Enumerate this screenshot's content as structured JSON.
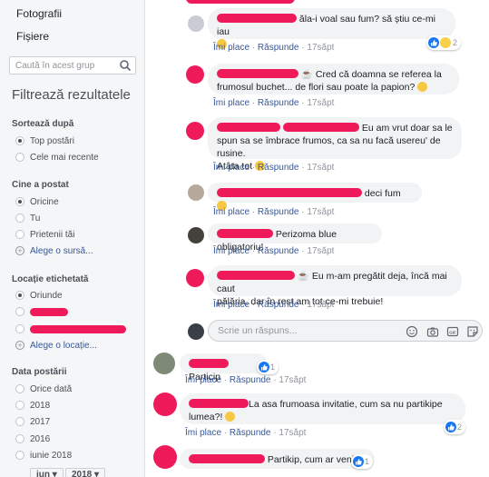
{
  "sidebar": {
    "links": [
      "Fotografii",
      "Fișiere"
    ],
    "search_placeholder": "Caută în acest grup",
    "filter_title": "Filtrează rezultatele",
    "sort": {
      "heading": "Sortează după",
      "options": [
        "Top postări",
        "Cele mai recente"
      ]
    },
    "posted_by": {
      "heading": "Cine a postat",
      "options": [
        "Oricine",
        "Tu",
        "Prietenii tăi"
      ],
      "choose_source": "Alege o sursă..."
    },
    "location": {
      "heading": "Locație etichetată",
      "options": [
        "Oriunde"
      ],
      "choose_location": "Alege o locație..."
    },
    "date": {
      "heading": "Data postării",
      "options": [
        "Orice dată",
        "2018",
        "2017",
        "2016",
        "iunie 2018"
      ],
      "month": "iun",
      "year": "2018"
    }
  },
  "comments": [
    {
      "text": "ăla-i voal sau fum? să știu ce-mi iau",
      "like": "Îmi place",
      "reply": "Răspunde",
      "time": "17săpt",
      "reaction_count": "2"
    },
    {
      "text_1": "Cred că doamna se referea la",
      "text_2": "frumosul buchet... de flori sau poate la papion?",
      "like": "Îmi place",
      "reply": "Răspunde",
      "time": "17săpt"
    },
    {
      "text_1": "Eu am vrut doar sa le",
      "text_2": "spun sa se îmbrace frumos, ca sa nu facă usereu' de rusine.",
      "text_3": "Atâta tot",
      "like": "Îmi place",
      "reply": "Răspunde",
      "time": "17săpt"
    },
    {
      "text": "deci fum",
      "like": "Îmi place",
      "reply": "Răspunde",
      "time": "17săpt"
    },
    {
      "text": "Perizoma blue obligatoriu!",
      "like": "Îmi place",
      "reply": "Răspunde",
      "time": "17săpt"
    },
    {
      "text_1": "Eu m-am pregătit deja, încă mai caut",
      "text_2": "pălăria, dar în rest am tot ce-mi trebuie!",
      "like": "Îmi place",
      "reply": "Răspunde",
      "time": "17săpt"
    },
    {
      "text": "Particip",
      "like": "Îmi place",
      "reply": "Răspunde",
      "time": "17săpt",
      "reaction_count": "1"
    },
    {
      "text_1": "La asa frumoasa invitatie, cum sa nu partikipe",
      "text_2": "lumea?!",
      "like": "Îmi place",
      "reply": "Răspunde",
      "time": "17săpt",
      "reaction_count": "2"
    },
    {
      "text": "Partikip, cum ar veni.",
      "reaction_count": "1"
    }
  ],
  "reply_placeholder": "Scrie un răspuns...",
  "colors": {
    "link": "#385898",
    "redaction": "#ee1a5a",
    "bubble": "#f2f3f5",
    "sidebar": "#f5f6f7"
  },
  "icons": [
    "search-icon",
    "like-reaction-icon",
    "haha-reaction-icon",
    "smiley-icon",
    "camera-icon",
    "gif-icon",
    "sticker-icon",
    "coffee-icon"
  ]
}
